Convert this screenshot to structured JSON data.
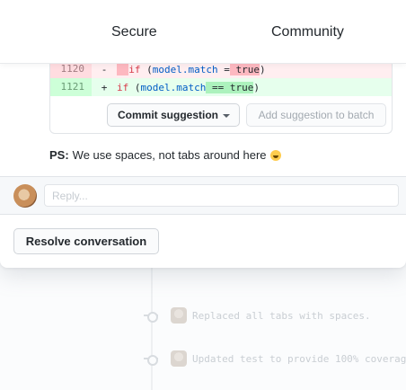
{
  "nav": {
    "secure": "Secure",
    "community": "Community"
  },
  "diff": {
    "deleted": {
      "line_number": "1120",
      "marker": "-",
      "kw": "if",
      "paren_open": " (",
      "var": "model.match",
      "op": " =",
      "value": " true",
      "paren_close": ")"
    },
    "added": {
      "line_number": "1121",
      "marker": "+",
      "kw": "if",
      "paren_open": " (",
      "var": "model.match",
      "op": " ==",
      "value": " true",
      "paren_close": ")"
    }
  },
  "suggestion": {
    "commit_label": "Commit suggestion",
    "batch_label": "Add suggestion to batch"
  },
  "comment": {
    "ps_label": "PS:",
    "ps_text": "We use spaces, not tabs around here",
    "emoji": "grinning-face-emoji"
  },
  "reply": {
    "placeholder": "Reply..."
  },
  "resolve_label": "Resolve conversation",
  "timeline": [
    {
      "text": "Replaced all tabs with spaces."
    },
    {
      "text": "Updated test to provide 100% coverag"
    }
  ],
  "colors": {
    "deleted_bg": "#ffeef0",
    "added_bg": "#e6ffed",
    "keyword": "#d73a49",
    "variable": "#005cc5"
  }
}
